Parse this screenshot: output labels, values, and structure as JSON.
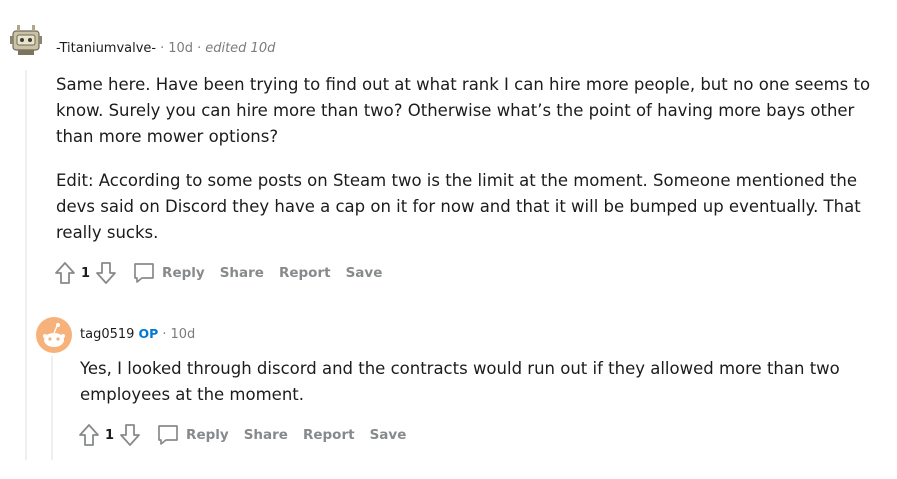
{
  "comments": [
    {
      "author": "-Titaniumvalve-",
      "time": "10d",
      "edited": "edited 10d",
      "paragraphs": [
        "Same here. Have been trying to find out at what rank I can hire more people, but no one seems to know. Surely you can hire more than two? Otherwise what’s the point of having more bays other than more mower options?",
        "Edit: According to some posts on Steam two is the limit at the moment. Someone mentioned the devs said on Discord they have a cap on it for now and that it will be bumped up eventually. That really sucks."
      ],
      "votes": "1",
      "actions": {
        "reply": "Reply",
        "share": "Share",
        "report": "Report",
        "save": "Save"
      }
    },
    {
      "author": "tag0519",
      "op_badge": "OP",
      "time": "10d",
      "paragraphs": [
        "Yes, I looked through discord and the contracts would run out if they allowed more than two employees at the moment."
      ],
      "votes": "1",
      "actions": {
        "reply": "Reply",
        "share": "Share",
        "report": "Report",
        "save": "Save"
      }
    }
  ],
  "colors": {
    "op": "#0079d3",
    "muted": "#7c7c7c",
    "thread": "#edeff1",
    "snoo_bg": "#f6b27a"
  }
}
